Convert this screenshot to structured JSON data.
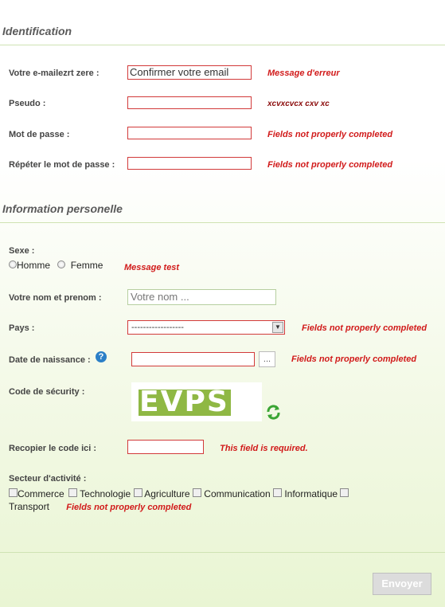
{
  "identification": {
    "title": "Identification",
    "email_label": "Votre e-mailezrt zere :",
    "email_placeholder": "Confirmer votre email",
    "email_error": "Message d'erreur",
    "pseudo_label": "Pseudo :",
    "pseudo_error": "xcvxcvcx cxv xc",
    "password_label": "Mot de passe :",
    "password_error": "Fields not properly completed",
    "repeat_password_label": "Répéter le mot de passe :",
    "repeat_password_error": "Fields not properly completed"
  },
  "personal": {
    "title": "Information personelle",
    "sexe_label": "Sexe :",
    "sexe_options": [
      "Homme",
      "Femme"
    ],
    "sexe_error": "Message test",
    "name_label": "Votre nom et prenom :",
    "name_placeholder": "Votre nom ...",
    "pays_label": "Pays :",
    "pays_selected": "------------------",
    "pays_error": "Fields not properly completed",
    "birthdate_label": "Date de naissance :",
    "birthdate_button": "...",
    "birthdate_error": "Fields not properly completed",
    "security_label": "Code de sécurity :",
    "captcha_text": "EVPSI",
    "copy_code_label": "Recopier le code ici :",
    "copy_code_error": "This field is required.",
    "sector_label": "Secteur d'activité :",
    "sectors": [
      "Commerce",
      "Technologie",
      "Agriculture",
      "Communication",
      "Informatique",
      "Transport"
    ],
    "sector_error": "Fields not properly completed"
  },
  "submit_label": "Envoyer",
  "colors": {
    "error": "#d11a1a",
    "captcha_bg": "#8fb844",
    "accent_green": "#3aa534"
  }
}
